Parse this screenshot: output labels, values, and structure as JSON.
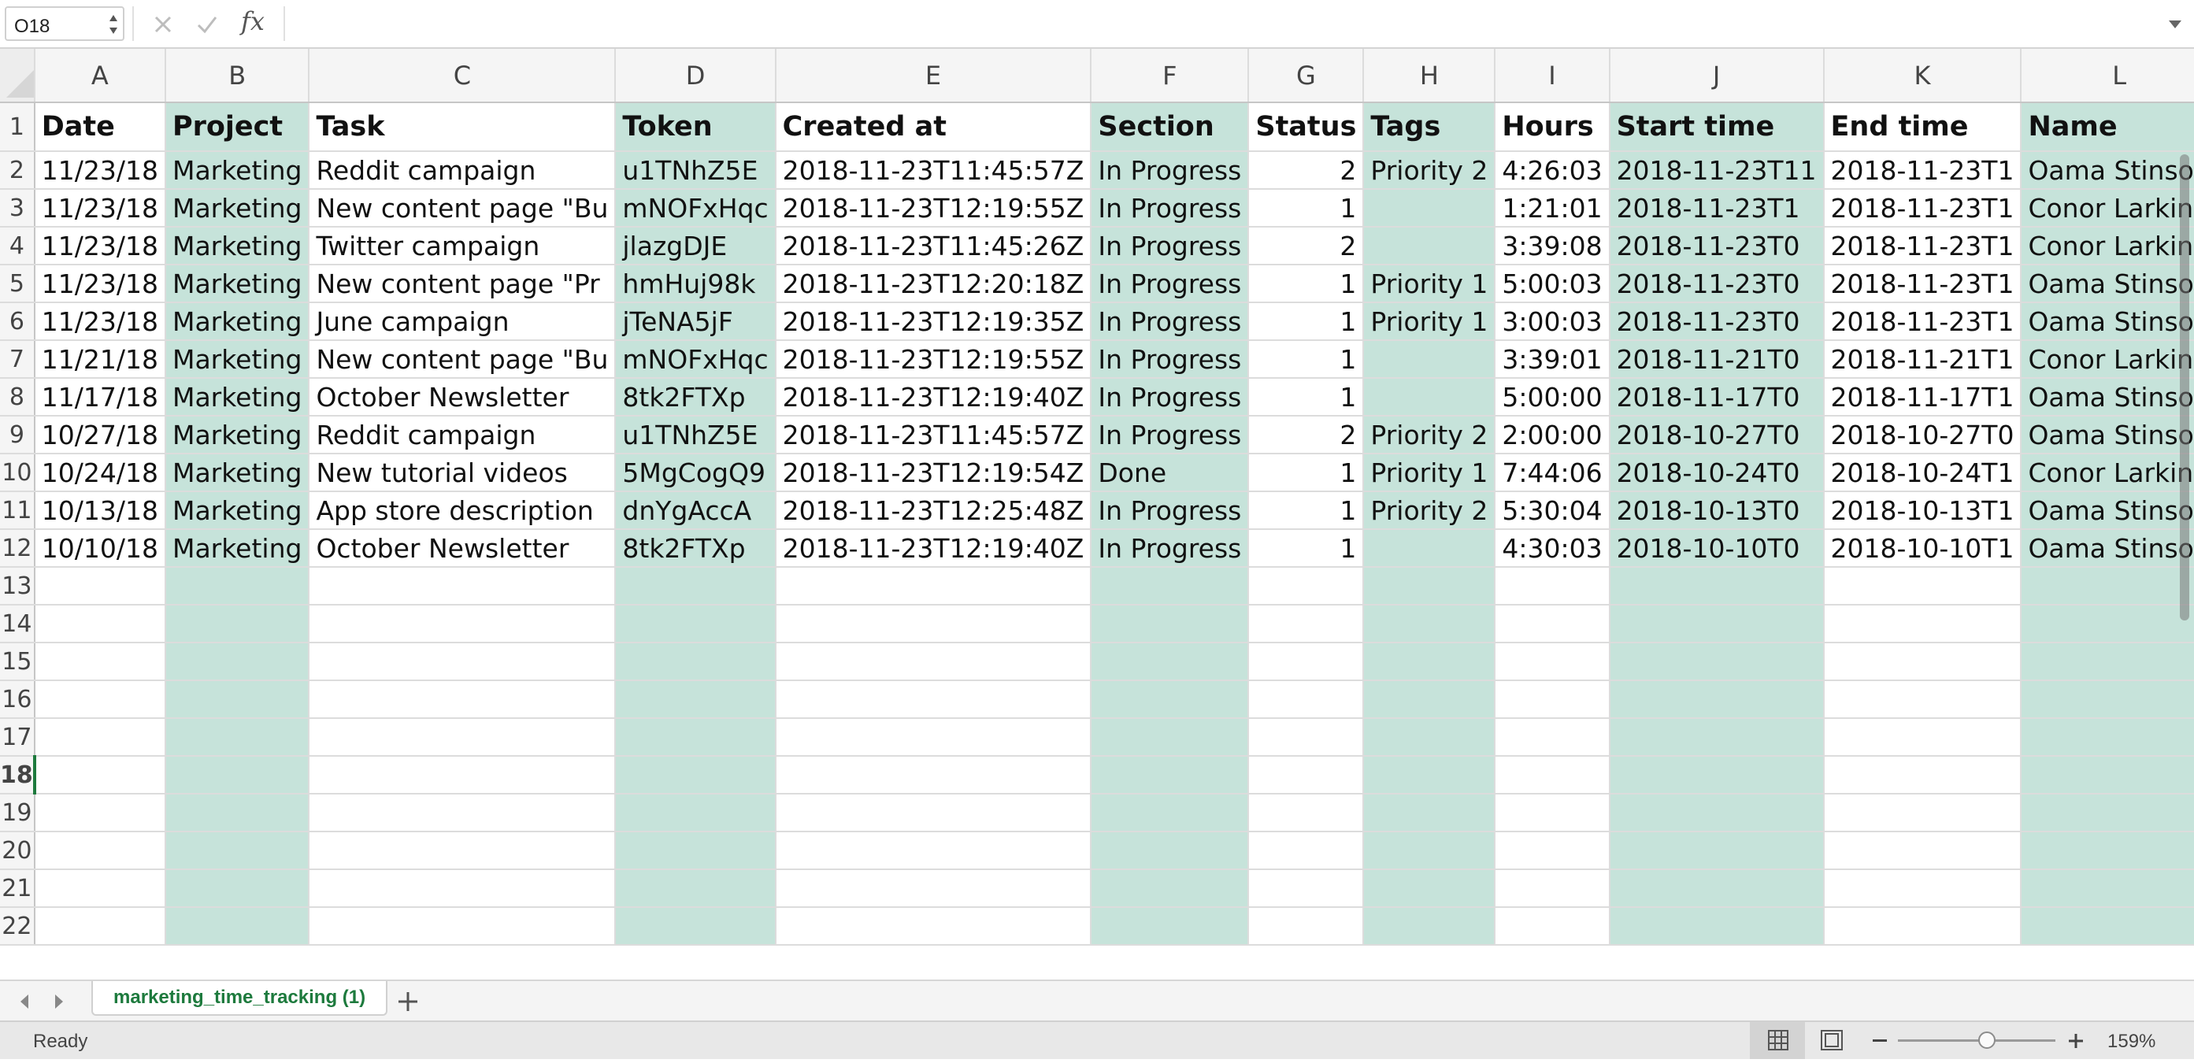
{
  "formula_bar": {
    "name_box": "O18",
    "fx_label": "fx",
    "formula": ""
  },
  "columns": [
    "A",
    "B",
    "C",
    "D",
    "E",
    "F",
    "G",
    "H",
    "I",
    "J",
    "K",
    "L"
  ],
  "rows": [
    {
      "n": "1",
      "cells": [
        "Date",
        "Project",
        "Task",
        "Token",
        "Created at",
        "Section",
        "Status",
        "Tags",
        "Hours",
        "Start time",
        "End time",
        "Name"
      ]
    },
    {
      "n": "2",
      "cells": [
        "11/23/18",
        "Marketing",
        "Reddit campaign",
        "u1TNhZ5E",
        "2018-11-23T11:45:57Z",
        "In Progress",
        "2",
        "Priority 2",
        "4:26:03",
        "2018-11-23T11",
        "2018-11-23T1",
        "Oama Stinson"
      ]
    },
    {
      "n": "3",
      "cells": [
        "11/23/18",
        "Marketing",
        "New content page \"Bu",
        "mNOFxHqc",
        "2018-11-23T12:19:55Z",
        "In Progress",
        "1",
        "",
        "1:21:01",
        "2018-11-23T1",
        "2018-11-23T1",
        "Conor Larkin"
      ]
    },
    {
      "n": "4",
      "cells": [
        "11/23/18",
        "Marketing",
        "Twitter campaign",
        "jlazgDJE",
        "2018-11-23T11:45:26Z",
        "In Progress",
        "2",
        "",
        "3:39:08",
        "2018-11-23T0",
        "2018-11-23T1",
        "Conor Larkin"
      ]
    },
    {
      "n": "5",
      "cells": [
        "11/23/18",
        "Marketing",
        "New content page \"Pr",
        "hmHuj98k",
        "2018-11-23T12:20:18Z",
        "In Progress",
        "1",
        "Priority 1",
        "5:00:03",
        "2018-11-23T0",
        "2018-11-23T1",
        "Oama Stinson"
      ]
    },
    {
      "n": "6",
      "cells": [
        "11/23/18",
        "Marketing",
        "June campaign",
        "jTeNA5jF",
        "2018-11-23T12:19:35Z",
        "In Progress",
        "1",
        "Priority 1",
        "3:00:03",
        "2018-11-23T0",
        "2018-11-23T1",
        "Oama Stinson"
      ]
    },
    {
      "n": "7",
      "cells": [
        "11/21/18",
        "Marketing",
        "New content page \"Bu",
        "mNOFxHqc",
        "2018-11-23T12:19:55Z",
        "In Progress",
        "1",
        "",
        "3:39:01",
        "2018-11-21T0",
        "2018-11-21T1",
        "Conor Larkin"
      ]
    },
    {
      "n": "8",
      "cells": [
        "11/17/18",
        "Marketing",
        "October Newsletter",
        "8tk2FTXp",
        "2018-11-23T12:19:40Z",
        "In Progress",
        "1",
        "",
        "5:00:00",
        "2018-11-17T0",
        "2018-11-17T1",
        "Oama Stinson"
      ]
    },
    {
      "n": "9",
      "cells": [
        "10/27/18",
        "Marketing",
        "Reddit campaign",
        "u1TNhZ5E",
        "2018-11-23T11:45:57Z",
        "In Progress",
        "2",
        "Priority 2",
        "2:00:00",
        "2018-10-27T0",
        "2018-10-27T0",
        "Oama Stinson"
      ]
    },
    {
      "n": "10",
      "cells": [
        "10/24/18",
        "Marketing",
        "New tutorial videos",
        "5MgCogQ9",
        "2018-11-23T12:19:54Z",
        "Done",
        "1",
        "Priority 1",
        "7:44:06",
        "2018-10-24T0",
        "2018-10-24T1",
        "Conor Larkin"
      ]
    },
    {
      "n": "11",
      "cells": [
        "10/13/18",
        "Marketing",
        "App store description",
        "dnYgAccA",
        "2018-11-23T12:25:48Z",
        "In Progress",
        "1",
        "Priority 2",
        "5:30:04",
        "2018-10-13T0",
        "2018-10-13T1",
        "Oama Stinson"
      ]
    },
    {
      "n": "12",
      "cells": [
        "10/10/18",
        "Marketing",
        "October Newsletter",
        "8tk2FTXp",
        "2018-11-23T12:19:40Z",
        "In Progress",
        "1",
        "",
        "4:30:03",
        "2018-10-10T0",
        "2018-10-10T1",
        "Oama Stinson"
      ]
    },
    {
      "n": "13",
      "cells": [
        "",
        "",
        "",
        "",
        "",
        "",
        "",
        "",
        "",
        "",
        "",
        ""
      ]
    },
    {
      "n": "14",
      "cells": [
        "",
        "",
        "",
        "",
        "",
        "",
        "",
        "",
        "",
        "",
        "",
        ""
      ]
    },
    {
      "n": "15",
      "cells": [
        "",
        "",
        "",
        "",
        "",
        "",
        "",
        "",
        "",
        "",
        "",
        ""
      ]
    },
    {
      "n": "16",
      "cells": [
        "",
        "",
        "",
        "",
        "",
        "",
        "",
        "",
        "",
        "",
        "",
        ""
      ]
    },
    {
      "n": "17",
      "cells": [
        "",
        "",
        "",
        "",
        "",
        "",
        "",
        "",
        "",
        "",
        "",
        ""
      ]
    },
    {
      "n": "18",
      "cells": [
        "",
        "",
        "",
        "",
        "",
        "",
        "",
        "",
        "",
        "",
        "",
        ""
      ]
    },
    {
      "n": "19",
      "cells": [
        "",
        "",
        "",
        "",
        "",
        "",
        "",
        "",
        "",
        "",
        "",
        ""
      ]
    },
    {
      "n": "20",
      "cells": [
        "",
        "",
        "",
        "",
        "",
        "",
        "",
        "",
        "",
        "",
        "",
        ""
      ]
    },
    {
      "n": "21",
      "cells": [
        "",
        "",
        "",
        "",
        "",
        "",
        "",
        "",
        "",
        "",
        "",
        ""
      ]
    },
    {
      "n": "22",
      "cells": [
        "",
        "",
        "",
        "",
        "",
        "",
        "",
        "",
        "",
        "",
        "",
        ""
      ]
    }
  ],
  "active_row": "18",
  "colors": {
    "alt_column_fill": "#c6e3da",
    "accent_green": "#1d7a3d"
  },
  "sheet_tabs": [
    {
      "label": "marketing_time_tracking (1)",
      "active": true
    }
  ],
  "status_bar": {
    "status": "Ready",
    "zoom": "159%"
  },
  "icons": {
    "cancel": "close-icon",
    "confirm": "check-icon",
    "function": "fx-icon",
    "add_sheet": "plus-icon",
    "normal_view": "grid-view-icon",
    "page_layout": "page-layout-icon"
  }
}
